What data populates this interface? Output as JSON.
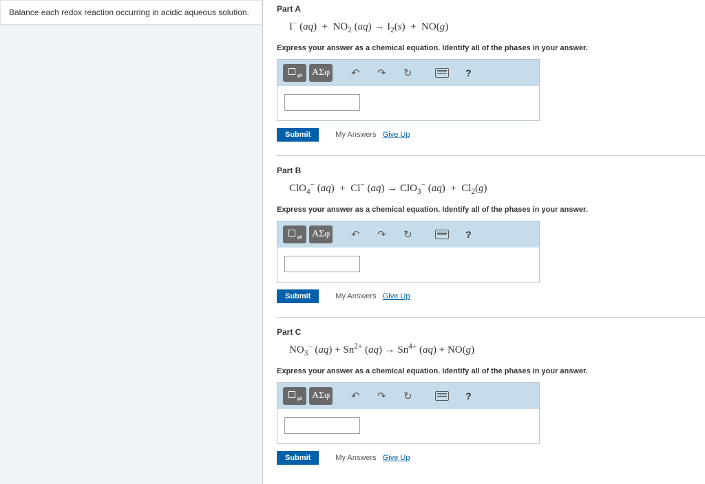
{
  "left": {
    "instruction": "Balance each redox reaction occurring in acidic aqueous solution."
  },
  "common": {
    "answer_instruction": "Express your answer as a chemical equation. Identify all of the phases in your answer.",
    "submit_label": "Submit",
    "my_answers_label": "My Answers",
    "give_up_label": "Give Up",
    "greek_label": "ΑΣφ",
    "help_label": "?"
  },
  "parts": {
    "a": {
      "header": "Part A",
      "equation_html": "I<sup>&minus;</sup> (<i>aq</i>) &nbsp;+&nbsp; NO<sub>2</sub> (<i>aq</i>) &rarr; I<sub>2</sub>(<i>s</i>) &nbsp;+&nbsp; NO(<i>g</i>)"
    },
    "b": {
      "header": "Part B",
      "equation_html": "ClO<sub>4</sub><sup>&minus;</sup> (<i>aq</i>) &nbsp;+&nbsp; Cl<sup>&minus;</sup> (<i>aq</i>) &rarr; ClO<sub>3</sub><sup>&minus;</sup> (<i>aq</i>) &nbsp;+&nbsp; Cl<sub>2</sub>(<i>g</i>)"
    },
    "c": {
      "header": "Part C",
      "equation_html": "NO<sub>3</sub><sup>&minus;</sup> (<i>aq</i>) + Sn<sup>2+</sup> (<i>aq</i>) &rarr; Sn<sup>4+</sup> (<i>aq</i>) + NO(<i>g</i>)"
    }
  }
}
